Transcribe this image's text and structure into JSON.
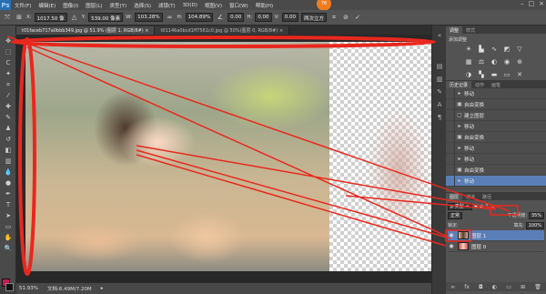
{
  "app": {
    "logo": "Ps",
    "menus": [
      "文件(F)",
      "编辑(E)",
      "图像(I)",
      "图层(L)",
      "类型(Y)",
      "选择(S)",
      "滤镜(T)",
      "3D(D)",
      "视图(V)",
      "窗口(W)",
      "帮助(H)"
    ],
    "badge": "76"
  },
  "options": {
    "x_label": "X:",
    "x_value": "1017.50 像",
    "y_label": "Y:",
    "y_value": "539.00 像素",
    "w_label": "W:",
    "w_value": "103.28%",
    "h_label": "H:",
    "h_value": "104.89%",
    "angle_value": "0.00",
    "h_skew_label": "H:",
    "h_skew_value": "0.00",
    "v_skew_label": "V:",
    "v_skew_value": "0.00",
    "interp_value": "两次立方"
  },
  "tabs": [
    {
      "label": "t01faceb717a0bbb349.jpg @ 51.9% (图层 1, RGB/8#) ×"
    },
    {
      "label": "t01146a0bcd1ff7561c0.jpg @ 50%(图层 0, RGB/8#) ×"
    }
  ],
  "status": {
    "zoom": "51.93%",
    "doc": "文档:6.49M/7.20M"
  },
  "adjust_panel": {
    "tabs": [
      "调整",
      "样式"
    ],
    "title": "添加调整"
  },
  "history_panel": {
    "tabs": [
      "历史记录",
      "动作",
      "画笔"
    ],
    "items": [
      {
        "label": "移动",
        "selected": false
      },
      {
        "label": "自由变换",
        "selected": false
      },
      {
        "label": "建立图层",
        "selected": false
      },
      {
        "label": "移动",
        "selected": false
      },
      {
        "label": "自由变换",
        "selected": false
      },
      {
        "label": "移动",
        "selected": false
      },
      {
        "label": "移动",
        "selected": false
      },
      {
        "label": "自由变换",
        "selected": false
      },
      {
        "label": "移动",
        "selected": true
      }
    ]
  },
  "layers_panel": {
    "tabs": [
      "图层",
      "通道",
      "路径"
    ],
    "blend_mode": "正常",
    "opacity_label": "不透明度:",
    "opacity_value": "35%",
    "lock_label": "锁定:",
    "fill_label": "填充:",
    "fill_value": "100%",
    "layers": [
      {
        "name": "图层 1",
        "selected": true
      },
      {
        "name": "图层 0",
        "selected": false
      }
    ]
  },
  "colors": {
    "annotation_red": "#e8281e",
    "foreground": "#c31a4f",
    "selection_blue": "#5a7fb8"
  }
}
